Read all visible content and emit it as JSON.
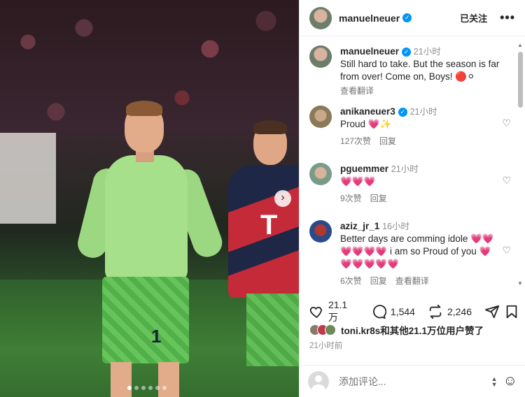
{
  "photo": {
    "nav_arrow": "›",
    "page_dots": 6,
    "active_dot": 0,
    "jersey_number": "1",
    "sponsor": "T"
  },
  "header": {
    "username": "manuelneuer",
    "follow_label": "已关注",
    "more_label": "•••"
  },
  "caption": {
    "username": "manuelneuer",
    "time": "21小时",
    "text": "Still hard to take. But the season is far from over! Come on, Boys! 🔴⚪",
    "translate": "查看翻译"
  },
  "comments": [
    {
      "username": "anikaneuer3",
      "verified": true,
      "time": "21小时",
      "text": "Proud 💗✨",
      "likes": "127次赞",
      "reply": "回复",
      "translate": ""
    },
    {
      "username": "pguemmer",
      "verified": false,
      "time": "21小时",
      "text": "💗💗💗",
      "likes": "9次赞",
      "reply": "回复",
      "translate": ""
    },
    {
      "username": "aziz_jr_1",
      "verified": false,
      "time": "16小时",
      "text": "Better days are comming idole 💗💗💗💗💗💗 i am so Proud of you 💗💗💗💗💗💗",
      "likes": "6次赞",
      "reply": "回复",
      "translate": "查看翻译"
    }
  ],
  "actions": {
    "likes": "21.1 万",
    "comments": "1,544",
    "reposts": "2,246"
  },
  "liked_by": {
    "user": "toni.kr8s",
    "rest": "和其他21.1万位用户赞了"
  },
  "post_time": "21小时前",
  "compose": {
    "placeholder": "添加评论..."
  },
  "colors": {
    "verified": "#0095f6",
    "heart": "#ed4956",
    "muted": "#737373"
  }
}
